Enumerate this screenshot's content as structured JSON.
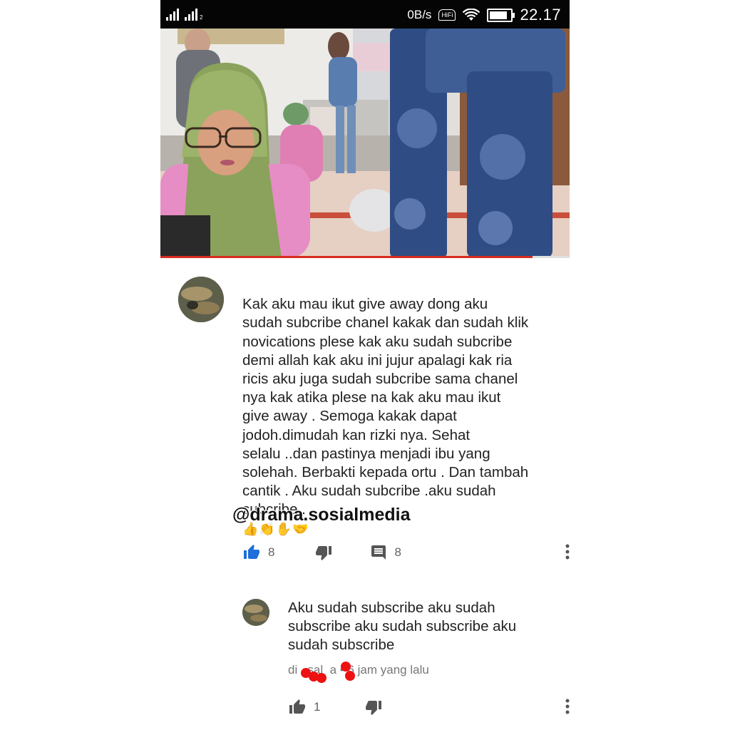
{
  "status_bar": {
    "network_speed": "0B/s",
    "hifi_label": "HiFi",
    "time": "22.17",
    "sim2_label": "2"
  },
  "video": {
    "progress": 0.91
  },
  "comment": {
    "text": "Kak aku mau  ikut give away dong aku\nsudah subcribe chanel kakak dan sudah klik\nnovications plese kak aku sudah subcribe\ndemi allah kak aku ini  jujur apalagi kak ria\nricis aku juga sudah subcribe sama chanel\nnya kak atika plese na kak aku mau ikut\ngive away . Semoga kakak dapat\njodoh.dimudah kan rizki nya. Sehat\nselalu ..dan pastinya menjadi ibu yang\nsolehah. Berbakti kepada ortu . Dan tambah\ncantik . Aku sudah subcribe .aku sudah\nsubcribe .",
    "emojis": "👍👏✋🤝",
    "like_count": "8",
    "reply_count": "8"
  },
  "watermark": "@drama.sosialmedia",
  "reply": {
    "text": "Aku sudah subscribe aku sudah\nsubscribe aku sudah subscribe aku\nsudah subscribe",
    "author_visible": "di   sal  a",
    "time_ago": "• 6 jam yang lalu",
    "like_count": "1"
  },
  "colors": {
    "accent_blue": "#1e6fd9",
    "icon_gray": "#606060",
    "progress_red": "#d92b1f",
    "redaction_red": "#ee1111"
  }
}
